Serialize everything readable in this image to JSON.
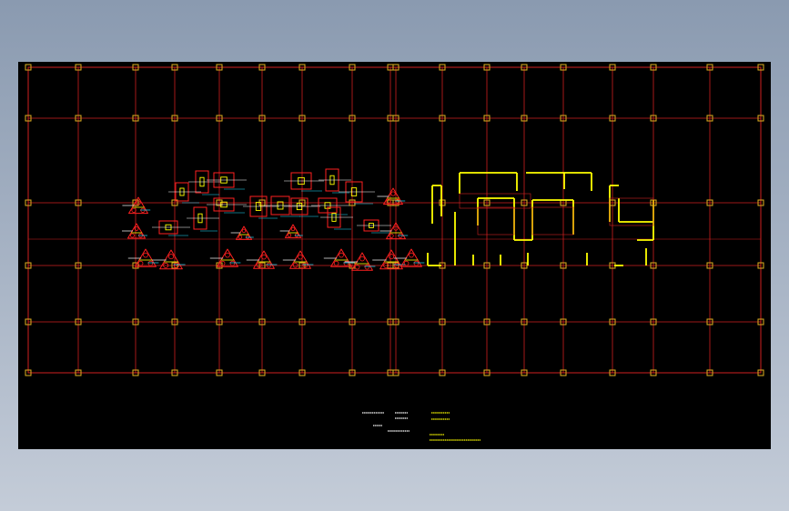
{
  "drawing": {
    "name": "cad-structural-plan",
    "colors": {
      "background": "#000000",
      "grid": "#d02020",
      "node": "#e0b020",
      "pile_cap": "#ff2020",
      "yellow": "#ffff00",
      "cyan": "#20e0ff",
      "white": "#ffffff"
    }
  },
  "title_block": {
    "lines": []
  }
}
